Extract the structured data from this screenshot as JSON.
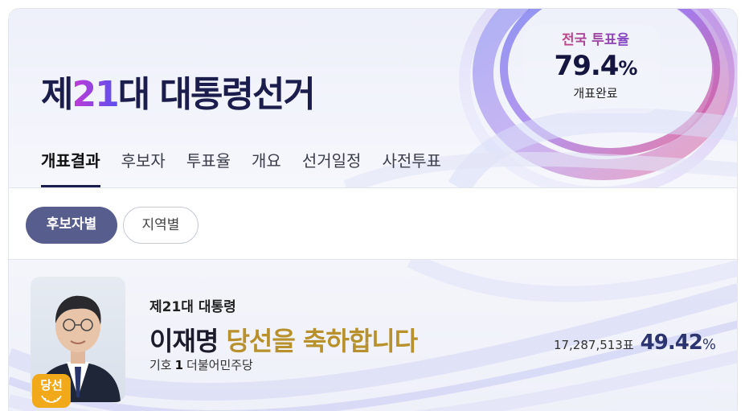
{
  "header": {
    "title_prefix": "제",
    "title_number": "21",
    "title_suffix": "대 대통령선거",
    "turnout_label": "전국 투표율",
    "turnout_value": "79.4",
    "turnout_unit": "%",
    "turnout_status": "개표완료"
  },
  "tabs": [
    {
      "label": "개표결과",
      "active": true
    },
    {
      "label": "후보자",
      "active": false
    },
    {
      "label": "투표율",
      "active": false
    },
    {
      "label": "개요",
      "active": false
    },
    {
      "label": "선거일정",
      "active": false
    },
    {
      "label": "사전투표",
      "active": false
    }
  ],
  "filters": [
    {
      "label": "후보자별",
      "active": true
    },
    {
      "label": "지역별",
      "active": false
    }
  ],
  "winner": {
    "subtitle": "제21대 대통령",
    "name": "이재명",
    "congrats": "당선을 축하합니다",
    "badge": "당선",
    "number_label": "기호",
    "number": "1",
    "party": "더불어민주당",
    "votes": "17,287,513표",
    "percent": "49.42",
    "percent_unit": "%"
  },
  "colors": {
    "accent": "#1b1d4d",
    "chip_active": "#575d8c",
    "gold": "#b8912c",
    "badge": "#f1a91a",
    "percent": "#2d3570"
  }
}
